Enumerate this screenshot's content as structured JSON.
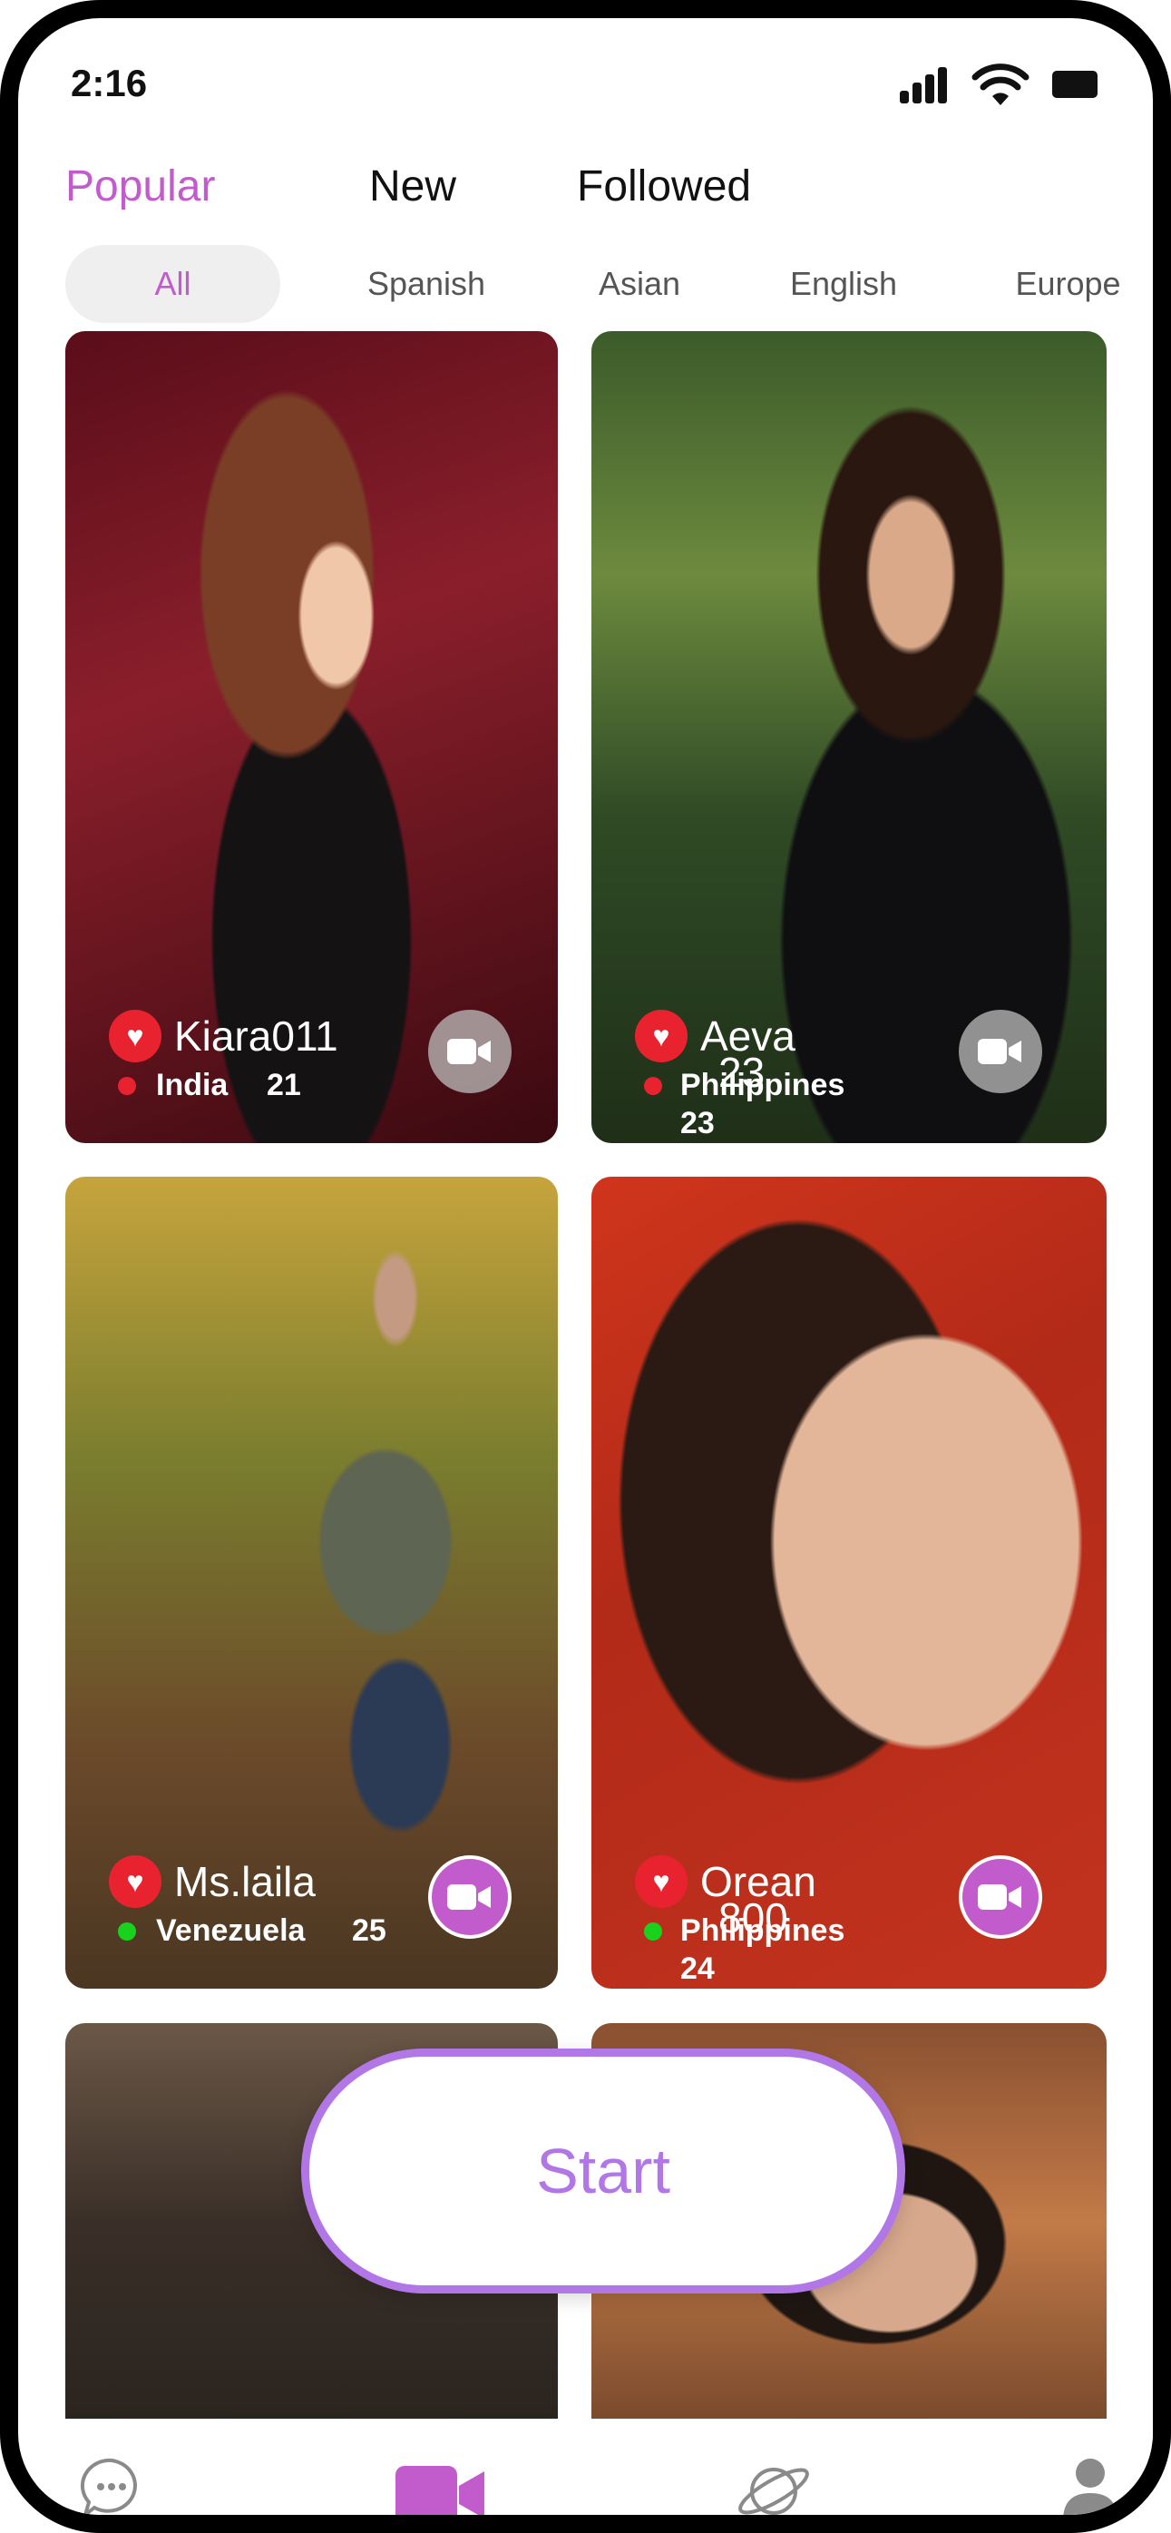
{
  "status_bar": {
    "time": "2:16"
  },
  "tabs": [
    {
      "label": "Popular",
      "active": true
    },
    {
      "label": "New",
      "active": false
    },
    {
      "label": "Followed",
      "active": false
    }
  ],
  "chips": [
    {
      "label": "All",
      "active": true
    },
    {
      "label": "Spanish"
    },
    {
      "label": "Asian"
    },
    {
      "label": "English"
    },
    {
      "label": "Europe"
    }
  ],
  "cards": [
    {
      "name": "Kiara011",
      "country": "India",
      "age": "21",
      "online": false
    },
    {
      "name": "Aeva",
      "name_extra": "23",
      "country": "Philippines",
      "age": "23",
      "online": false
    },
    {
      "name": "Ms.laila",
      "country": "Venezuela",
      "age": "25",
      "online": true
    },
    {
      "name": "Orean",
      "name_extra": "800",
      "country": "Philippines",
      "age": "24",
      "online": true
    }
  ],
  "start_button": {
    "label": "Start"
  },
  "colors": {
    "accent": "#c25ccc",
    "start_purple": "#b177e6",
    "offline_dot": "#e8232f",
    "online_dot": "#19d21e"
  },
  "icons": {
    "nav": [
      "chat-bubble-icon",
      "video-camera-icon",
      "planet-icon",
      "user-icon"
    ]
  }
}
